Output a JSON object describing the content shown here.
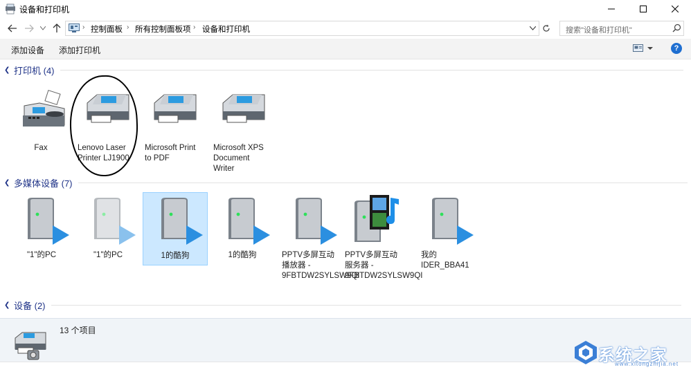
{
  "window": {
    "title": "设备和打印机"
  },
  "nav": {
    "breadcrumbs": [
      "控制面板",
      "所有控制面板项",
      "设备和打印机"
    ],
    "search_placeholder": "搜索\"设备和打印机\""
  },
  "toolbar": {
    "add_device": "添加设备",
    "add_printer": "添加打印机",
    "help_label": "?"
  },
  "groups": {
    "printers": {
      "label": "打印机 (4)",
      "items": [
        {
          "name": "Fax",
          "icon": "fax-icon"
        },
        {
          "name": "Lenovo Laser Printer LJ1900",
          "icon": "printer-icon"
        },
        {
          "name": "Microsoft Print to PDF",
          "icon": "printer-icon"
        },
        {
          "name": "Microsoft XPS Document Writer",
          "icon": "printer-icon"
        }
      ]
    },
    "media": {
      "label": "多媒体设备 (7)",
      "items": [
        {
          "name": "\"1\"的PC",
          "icon": "media-server-icon"
        },
        {
          "name": "\"1\"的PC",
          "icon": "media-server-icon",
          "dimmed": true
        },
        {
          "name": "1的酷狗",
          "icon": "media-server-icon",
          "selected": true
        },
        {
          "name": "1的酷狗",
          "icon": "media-server-icon"
        },
        {
          "name": "PPTV多屏互动播放器 - 9FBTDW2SYLSW9QI",
          "icon": "media-server-icon"
        },
        {
          "name": "PPTV多屏互动服务器 - 9FBTDW2SYLSW9QI",
          "icon": "media-server-film-icon"
        },
        {
          "name": "我的 IDER_BBA41",
          "icon": "media-server-icon"
        }
      ]
    },
    "devices": {
      "label": "设备 (2)"
    }
  },
  "status": {
    "item_count": "13 个项目"
  },
  "watermark": {
    "text": "系统之家",
    "url": "www.xitongzhijia.net"
  },
  "colors": {
    "group_label": "#1e3287",
    "selection_bg": "#cce8ff",
    "play_arrow": "#2b8fe0"
  }
}
